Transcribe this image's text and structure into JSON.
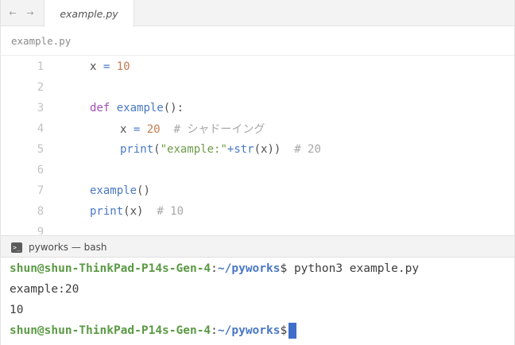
{
  "tabbar": {
    "back_icon": "arrow-left-icon",
    "forward_icon": "arrow-right-icon",
    "back_glyph": "←",
    "forward_glyph": "→",
    "active_tab": "example.py"
  },
  "header": {
    "filename": "example.py"
  },
  "code": {
    "line_numbers": [
      "1",
      "2",
      "3",
      "4",
      "5",
      "6",
      "7",
      "8",
      "9"
    ],
    "l1": {
      "var": "x",
      "op": "=",
      "num": "10"
    },
    "l3": {
      "kw": "def",
      "name": "example",
      "rest": "():"
    },
    "l4": {
      "var": "x",
      "op": "=",
      "num": "20",
      "comment": "# シャドーイング"
    },
    "l5": {
      "fn": "print",
      "open": "(",
      "str": "\"example:\"",
      "plus": "+",
      "fn2": "str",
      "rest": "(x))",
      "comment": "# 20"
    },
    "l7": {
      "fn": "example",
      "rest": "()"
    },
    "l8": {
      "fn": "print",
      "rest": "(x)",
      "comment": "# 10"
    }
  },
  "terminal": {
    "tab_label": "pyworks — bash",
    "tab_icon": "terminal-icon",
    "lines": {
      "prompt1_user": "shun@shun-ThinkPad-P14s-Gen-4",
      "prompt1_colon": ":",
      "prompt1_path": "~/pyworks",
      "prompt1_dollar": "$",
      "prompt1_cmd": " python3 example.py",
      "out1": "example:20",
      "out2": "10",
      "prompt2_user": "shun@shun-ThinkPad-P14s-Gen-4",
      "prompt2_colon": ":",
      "prompt2_path": "~/pyworks",
      "prompt2_dollar": "$"
    }
  },
  "colors": {
    "keyword": "#a04fb0",
    "function": "#4a78c4",
    "number": "#c57b4d",
    "string": "#6e9b4a",
    "comment": "#a8a8a8",
    "prompt_user": "#5b9a45",
    "cursor": "#3f6ec9"
  }
}
